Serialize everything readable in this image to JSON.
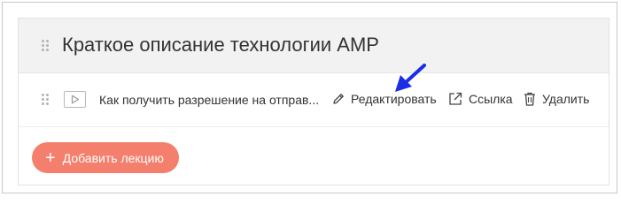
{
  "section": {
    "title": "Краткое описание технологии AMP"
  },
  "lecture": {
    "title": "Как получить разрешение на отправ...",
    "actions": {
      "edit_label": "Редактировать",
      "link_label": "Ссылка",
      "delete_label": "Удалить"
    },
    "icons": {
      "drag": "drag-handle-icon",
      "type": "video-play-icon",
      "edit": "pencil-icon",
      "link": "external-link-icon",
      "delete": "trash-icon"
    }
  },
  "add_button": {
    "plus": "+",
    "label": "Добавить лекцию"
  },
  "colors": {
    "accent_button": "#f47f6c",
    "annotation_arrow": "#1a2ee6",
    "header_bg": "#f2f2f2"
  }
}
